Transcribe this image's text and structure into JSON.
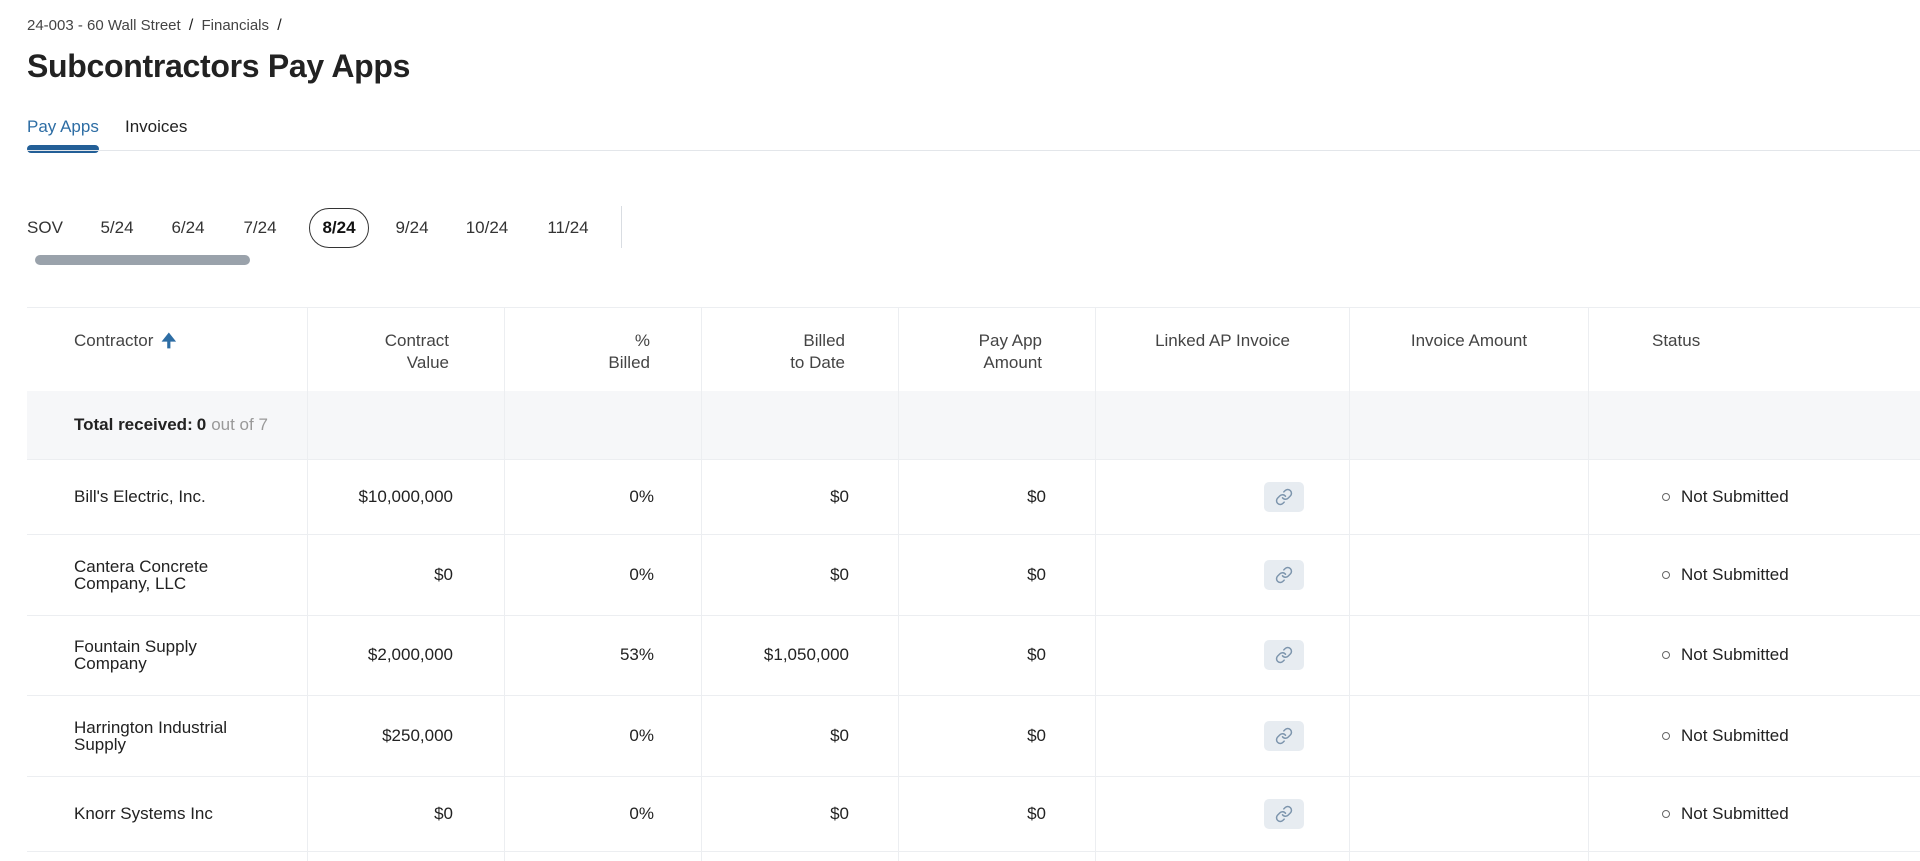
{
  "breadcrumb": {
    "project": "24-003 - 60 Wall Street",
    "sep1": "/",
    "section": "Financials",
    "sep2": "/"
  },
  "page": {
    "title": "Subcontractors Pay Apps"
  },
  "tabs": [
    {
      "label": "Pay Apps",
      "active": true
    },
    {
      "label": "Invoices",
      "active": false
    }
  ],
  "periods": [
    {
      "label": "SOV"
    },
    {
      "label": "5/24"
    },
    {
      "label": "6/24"
    },
    {
      "label": "7/24"
    },
    {
      "label": "8/24",
      "active": true
    },
    {
      "label": "9/24"
    },
    {
      "label": "10/24"
    },
    {
      "label": "11/24"
    }
  ],
  "table": {
    "headers": {
      "contractor": "Contractor",
      "contract_value": [
        "Contract",
        "Value"
      ],
      "percent_billed": [
        "%",
        "Billed"
      ],
      "billed_to_date": [
        "Billed",
        "to Date"
      ],
      "pay_app_amount": [
        "Pay App",
        "Amount"
      ],
      "linked_ap_invoice": "Linked AP Invoice",
      "invoice_amount": "Invoice Amount",
      "status": "Status"
    },
    "summary": {
      "label": "Total received:",
      "count": "0",
      "of": "out of 7"
    },
    "rows": [
      {
        "contractor": "Bill's Electric, Inc.",
        "contract_value": "$10,000,000",
        "percent_billed": "0%",
        "billed_to_date": "$0",
        "pay_app_amount": "$0",
        "invoice_amount": "",
        "status": "Not Submitted"
      },
      {
        "contractor": "Cantera Concrete Company, LLC",
        "contract_value": "$0",
        "percent_billed": "0%",
        "billed_to_date": "$0",
        "pay_app_amount": "$0",
        "invoice_amount": "",
        "status": "Not Submitted"
      },
      {
        "contractor": "Fountain Supply Company",
        "contract_value": "$2,000,000",
        "percent_billed": "53%",
        "billed_to_date": "$1,050,000",
        "pay_app_amount": "$0",
        "invoice_amount": "",
        "status": "Not Submitted"
      },
      {
        "contractor": "Harrington Industrial Supply",
        "contract_value": "$250,000",
        "percent_billed": "0%",
        "billed_to_date": "$0",
        "pay_app_amount": "$0",
        "invoice_amount": "",
        "status": "Not Submitted"
      },
      {
        "contractor": "Knorr Systems Inc",
        "contract_value": "$0",
        "percent_billed": "0%",
        "billed_to_date": "$0",
        "pay_app_amount": "$0",
        "invoice_amount": "",
        "status": "Not Submitted"
      }
    ]
  },
  "icons": {
    "sort": "arrow-up-icon",
    "link": "link-icon",
    "status": "circle-outline-icon"
  },
  "colors": {
    "accent": "#2d6da4",
    "tab_indicator": "#235f97",
    "link_button_bg": "#e7ecf1",
    "totals_bg": "#f6f7f9"
  }
}
